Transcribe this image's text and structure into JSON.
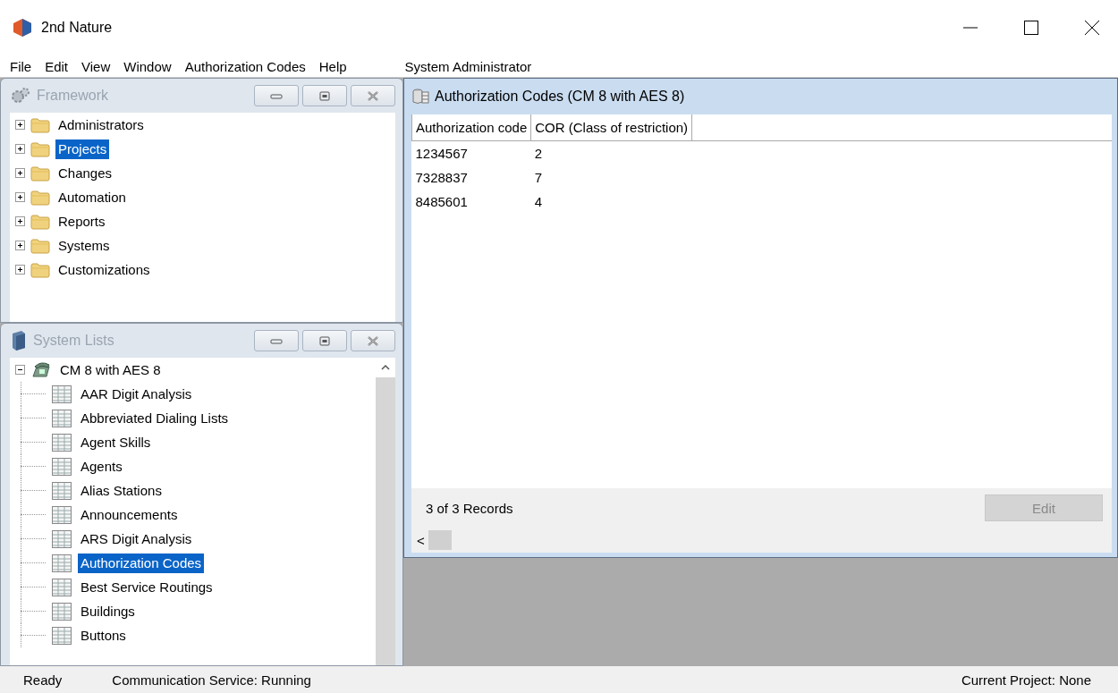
{
  "window": {
    "title": "2nd Nature"
  },
  "menu": [
    {
      "label": "File"
    },
    {
      "label": "Edit"
    },
    {
      "label": "View"
    },
    {
      "label": "Window"
    },
    {
      "label": "Authorization Codes"
    },
    {
      "label": "Help"
    }
  ],
  "user": "System Administrator",
  "framework": {
    "title": "Framework",
    "items": [
      {
        "label": "Administrators",
        "selected": false,
        "expanded": false
      },
      {
        "label": "Projects",
        "selected": true,
        "expanded": false
      },
      {
        "label": "Changes",
        "selected": false,
        "expanded": false
      },
      {
        "label": "Automation",
        "selected": false,
        "expanded": false
      },
      {
        "label": "Reports",
        "selected": false,
        "expanded": false
      },
      {
        "label": "Systems",
        "selected": false,
        "expanded": false
      },
      {
        "label": "Customizations",
        "selected": false,
        "expanded": false
      }
    ]
  },
  "system_lists": {
    "title": "System Lists",
    "items": [
      {
        "label": "CM 8 with AES 8",
        "selected": false,
        "expanded": true,
        "children": [
          {
            "label": "AAR Digit Analysis",
            "selected": false
          },
          {
            "label": "Abbreviated Dialing Lists",
            "selected": false
          },
          {
            "label": "Agent Skills",
            "selected": false
          },
          {
            "label": "Agents",
            "selected": false
          },
          {
            "label": "Alias Stations",
            "selected": false
          },
          {
            "label": "Announcements",
            "selected": false
          },
          {
            "label": "ARS Digit Analysis",
            "selected": false
          },
          {
            "label": "Authorization Codes",
            "selected": true
          },
          {
            "label": "Best Service Routings",
            "selected": false
          },
          {
            "label": "Buildings",
            "selected": false
          },
          {
            "label": "Buttons",
            "selected": false
          }
        ]
      }
    ]
  },
  "list_window": {
    "title": "Authorization Codes (CM 8 with AES 8)",
    "table": {
      "columns": [
        "Authorization code",
        "COR (Class of restriction)"
      ],
      "rows": [
        [
          "1234567",
          "2"
        ],
        [
          "7328837",
          "7"
        ],
        [
          "8485601",
          "4"
        ]
      ]
    },
    "records": "3 of 3 Records",
    "edit_button": {
      "label": "Edit",
      "disabled": true
    },
    "scroll_left": "<"
  },
  "status_bar": {
    "ready": "Ready",
    "service": "Communication Service: Running",
    "project": "Current Project: None"
  }
}
